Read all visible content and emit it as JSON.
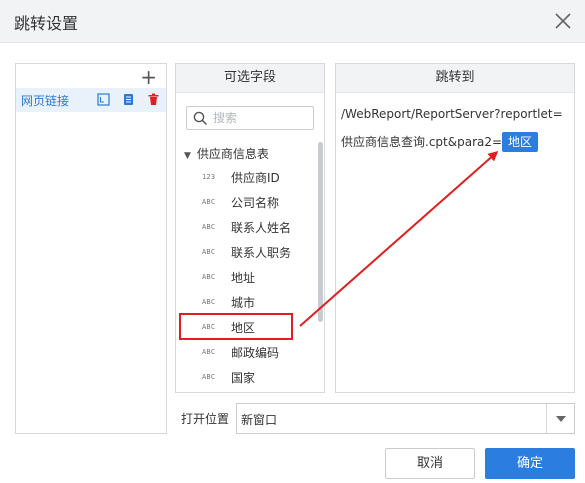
{
  "dialog": {
    "title": "跳转设置"
  },
  "left_panel": {
    "add_symbol": "+",
    "link_item_label": "网页链接"
  },
  "fields_panel": {
    "header": "可选字段",
    "search_placeholder": "搜索",
    "group_label": "供应商信息表",
    "fields": [
      {
        "type": "123",
        "name": "供应商ID"
      },
      {
        "type": "ABC",
        "name": "公司名称"
      },
      {
        "type": "ABC",
        "name": "联系人姓名"
      },
      {
        "type": "ABC",
        "name": "联系人职务"
      },
      {
        "type": "ABC",
        "name": "地址"
      },
      {
        "type": "ABC",
        "name": "城市"
      },
      {
        "type": "ABC",
        "name": "地区"
      },
      {
        "type": "ABC",
        "name": "邮政编码"
      },
      {
        "type": "ABC",
        "name": "国家"
      }
    ],
    "highlighted_field": "地区"
  },
  "target_panel": {
    "header": "跳转到",
    "url_text": "/WebReport/ReportServer?reportlet=供应商信息查询.cpt&para2=",
    "param_chip": "地区"
  },
  "open_position": {
    "label": "打开位置",
    "value": "新窗口"
  },
  "buttons": {
    "cancel": "取消",
    "ok": "确定"
  },
  "colors": {
    "accent": "#2c7de0",
    "annotation_red": "#e02020",
    "header_bg": "#f2f3f5"
  }
}
